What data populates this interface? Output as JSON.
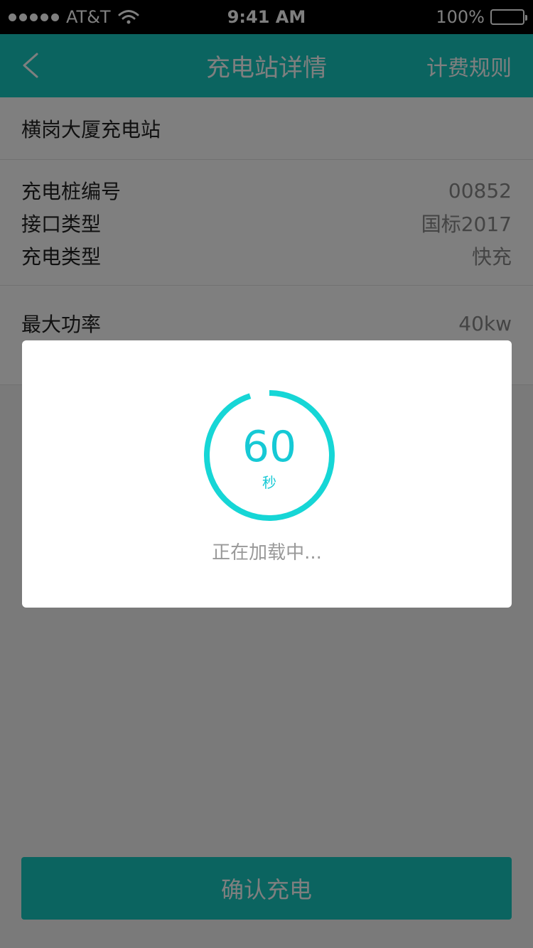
{
  "status_bar": {
    "carrier": "AT&T",
    "time": "9:41 AM",
    "battery": "100%"
  },
  "header": {
    "title": "充电站详情",
    "right_action": "计费规则"
  },
  "station": {
    "name": "横岗大厦充电站"
  },
  "details": [
    {
      "label": "充电桩编号",
      "value": "00852"
    },
    {
      "label": "接口类型",
      "value": "国标2017"
    },
    {
      "label": "充电类型",
      "value": "快充"
    }
  ],
  "power": {
    "label": "最大功率",
    "value": "40kw"
  },
  "confirm_button": "确认充电",
  "dialog": {
    "countdown": "60",
    "unit": "秒",
    "message": "正在加载中...",
    "ring_progress": 0.95
  },
  "colors": {
    "accent": "#16c9c1",
    "ring": "#16d6d6"
  }
}
